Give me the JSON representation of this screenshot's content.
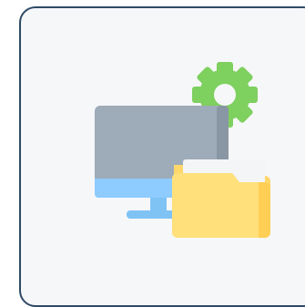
{
  "card": {
    "icon": "computer-folder-settings-icon"
  },
  "colors": {
    "border": "#2f4a66",
    "card_background": "#f6f7f9",
    "gear": "#7ed05f",
    "monitor_body": "#9eabb8",
    "monitor_side": "#8996a3",
    "screen_bar": "#8ecbff",
    "stand": "#7fc3f5",
    "paper": "#f4f5f7",
    "folder_back": "#ffd76a",
    "folder_front": "#ffe07a"
  }
}
